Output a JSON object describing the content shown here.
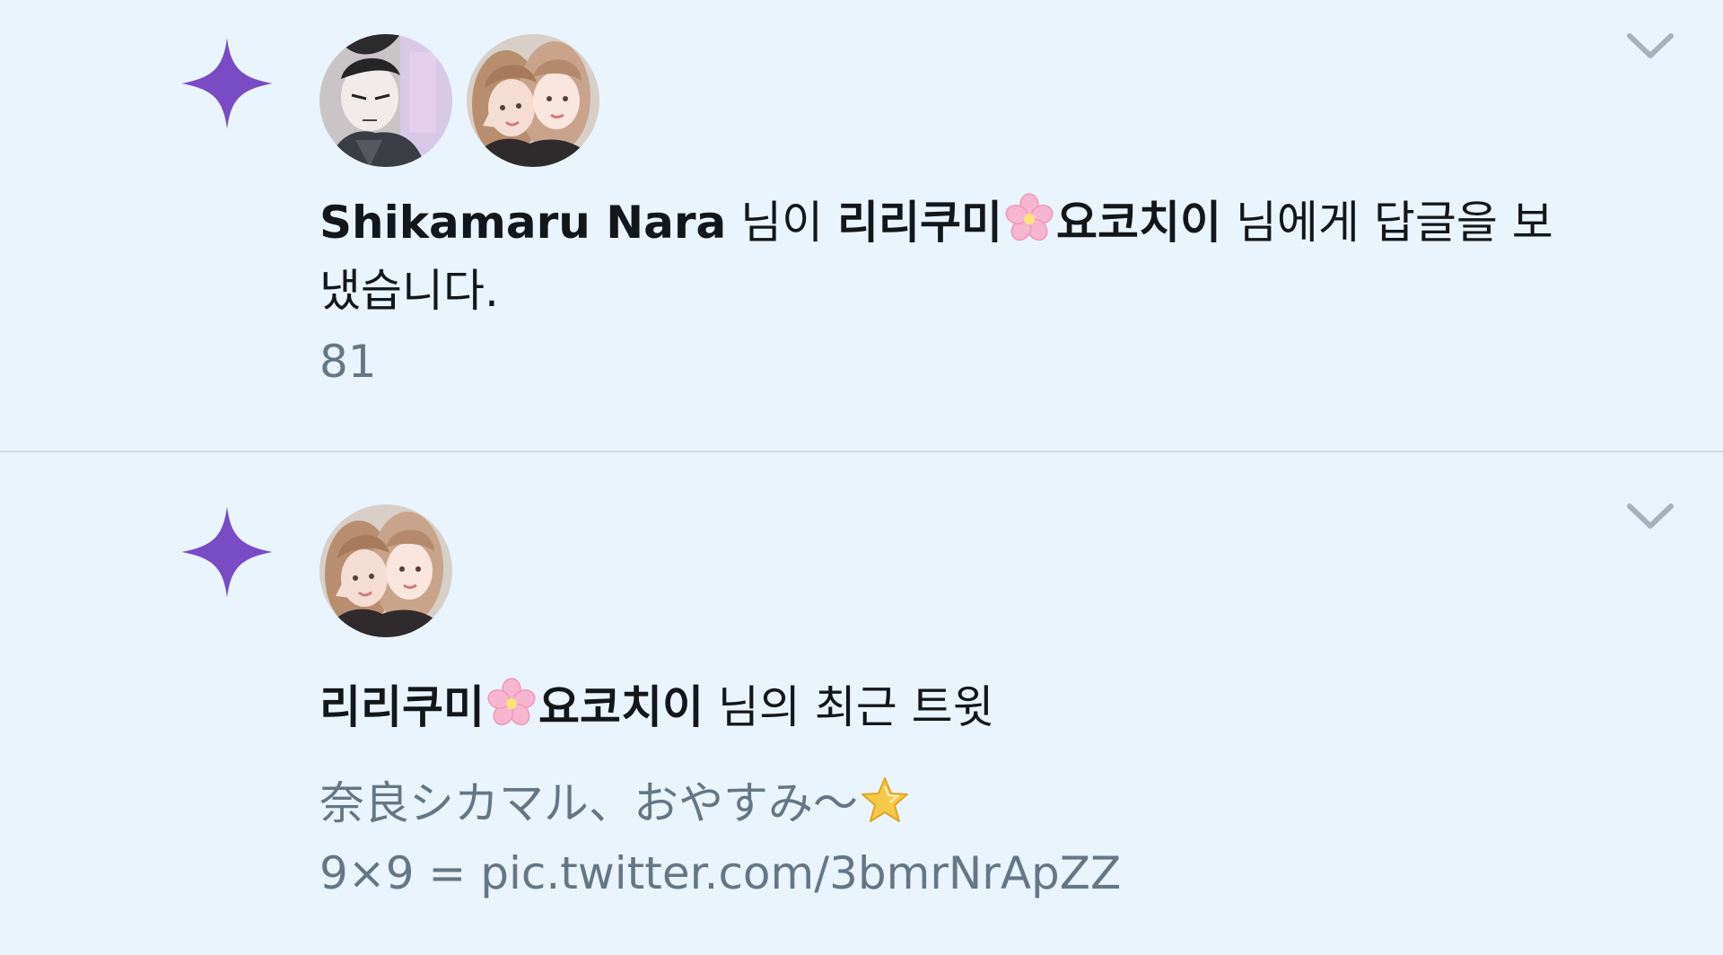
{
  "colors": {
    "background": "#eaf4fd",
    "spark": "#794bc4",
    "secondary_text": "#657786",
    "divider": "#d3dbe3"
  },
  "notifications": [
    {
      "icon": "sparkle-icon",
      "avatars": [
        "shikamaru-avatar",
        "rirukumi-avatar"
      ],
      "actor": "Shikamaru Nara",
      "text_1": " 님이 ",
      "target_a": "리리쿠미",
      "target_emoji": "cherry-blossom-emoji",
      "target_b": "요코치이",
      "text_2": " 님에게 답글을 보냈습니다.",
      "count": "81"
    },
    {
      "icon": "sparkle-icon",
      "avatars": [
        "rirukumi-avatar"
      ],
      "target_a": "리리쿠미",
      "target_emoji": "cherry-blossom-emoji",
      "target_b": "요코치이",
      "text_1": " 님의 최근 트윗",
      "tweet_line_1": "奈良シカマル、おやすみ〜",
      "tweet_emoji": "star-emoji",
      "tweet_line_2_prefix": "9×9 = ",
      "tweet_link": "pic.twitter.com/3bmrNrApZZ"
    }
  ]
}
